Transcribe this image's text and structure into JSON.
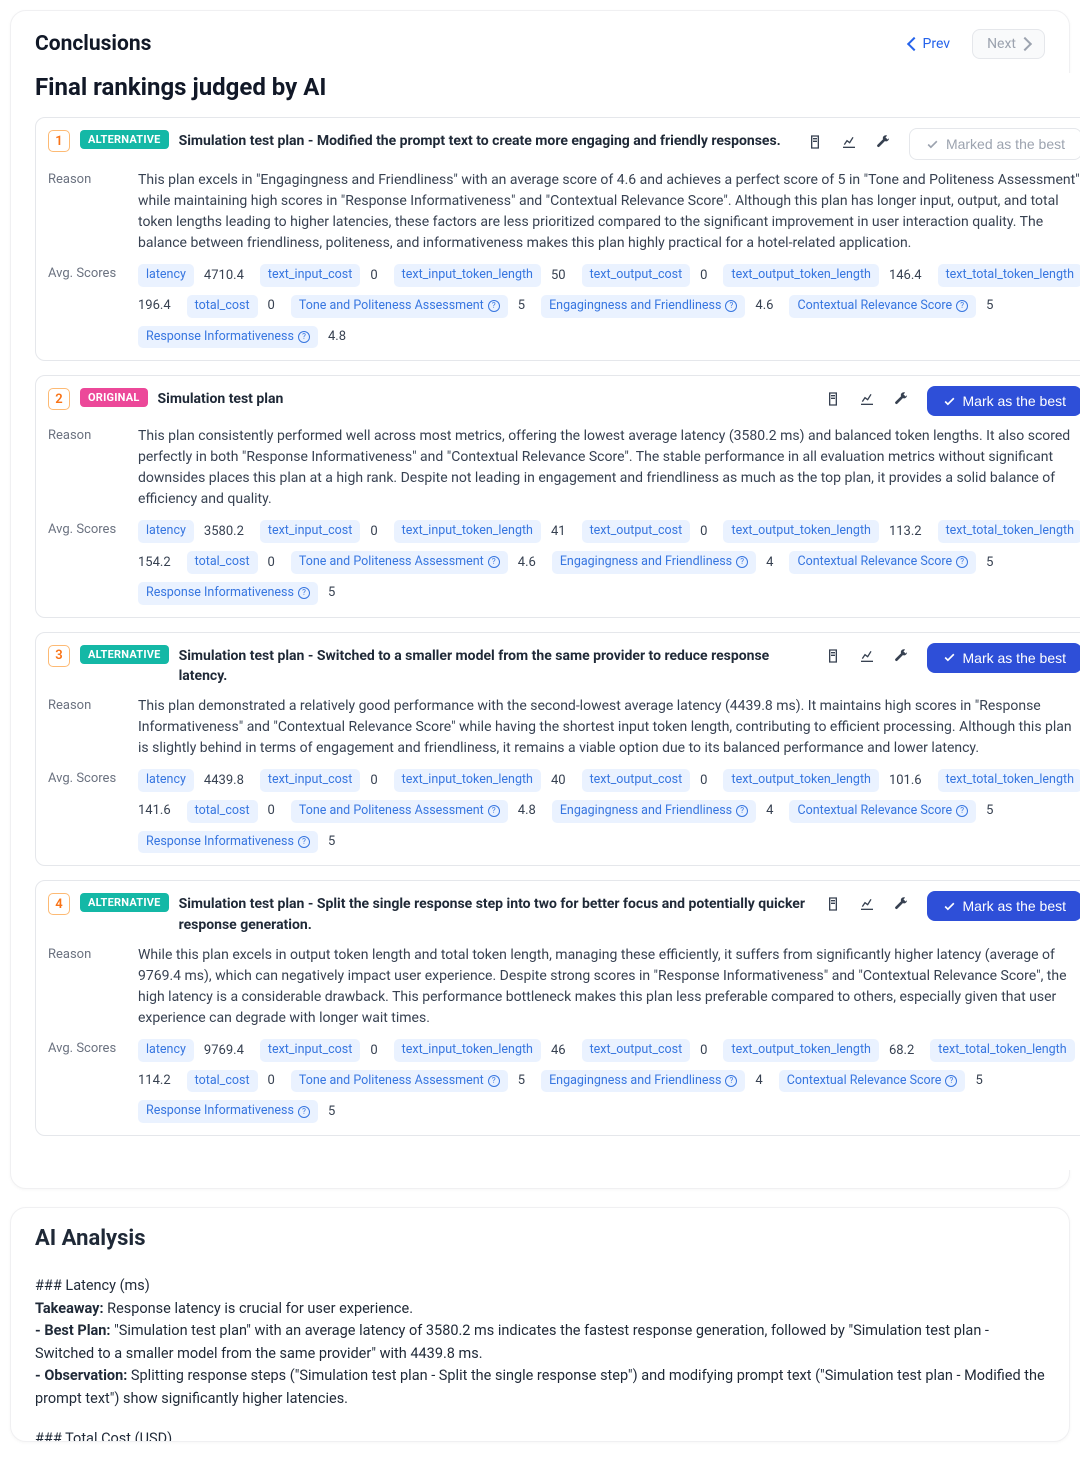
{
  "header": {
    "title": "Conclusions",
    "prev": "Prev",
    "next": "Next"
  },
  "rankings": {
    "title": "Final rankings judged by AI",
    "metric_labels": {
      "latency": "latency",
      "text_input_cost": "text_input_cost",
      "text_input_token_length": "text_input_token_length",
      "text_output_cost": "text_output_cost",
      "text_output_token_length": "text_output_token_length",
      "text_total_token_length": "text_total_token_length",
      "total_cost": "total_cost",
      "tone": "Tone and Politeness Assessment",
      "engage": "Engagingness and Friendliness",
      "context": "Contextual Relevance Score",
      "inform": "Response Informativeness"
    },
    "items": [
      {
        "rank": "1",
        "badge": "ALTERNATIVE",
        "badge_type": "alt",
        "title": "Simulation test plan - Modified the prompt text to create more engaging and friendly responses.",
        "best": {
          "marked": true,
          "label": "Marked as the best"
        },
        "reason": "This plan excels in \"Engagingness and Friendliness\" with an average score of 4.6 and achieves a perfect score of 5 in \"Tone and Politeness Assessment\" while maintaining high scores in \"Response Informativeness\" and \"Contextual Relevance Score\". Although this plan has longer input, output, and total token lengths leading to higher latencies, these factors are less prioritized compared to the significant improvement in user interaction quality. The balance between friendliness, politeness, and informativeness makes this plan highly practical for a hotel-related application.",
        "scores": {
          "latency": "4710.4",
          "text_input_cost": "0",
          "text_input_token_length": "50",
          "text_output_cost": "0",
          "text_output_token_length": "146.4",
          "text_total_token_length": "196.4",
          "total_cost": "0",
          "tone": "5",
          "engage": "4.6",
          "context": "5",
          "inform": "4.8"
        }
      },
      {
        "rank": "2",
        "badge": "ORIGINAL",
        "badge_type": "orig",
        "title": "Simulation test plan",
        "best": {
          "marked": false,
          "label": "Mark as the best"
        },
        "reason": "This plan consistently performed well across most metrics, offering the lowest average latency (3580.2 ms) and balanced token lengths. It also scored perfectly in both \"Response Informativeness\" and \"Contextual Relevance Score\". The stable performance in all evaluation metrics without significant downsides places this plan at a high rank. Despite not leading in engagement and friendliness as much as the top plan, it provides a solid balance of efficiency and quality.",
        "scores": {
          "latency": "3580.2",
          "text_input_cost": "0",
          "text_input_token_length": "41",
          "text_output_cost": "0",
          "text_output_token_length": "113.2",
          "text_total_token_length": "154.2",
          "total_cost": "0",
          "tone": "4.6",
          "engage": "4",
          "context": "5",
          "inform": "5"
        }
      },
      {
        "rank": "3",
        "badge": "ALTERNATIVE",
        "badge_type": "alt",
        "title": "Simulation test plan - Switched to a smaller model from the same provider to reduce response latency.",
        "best": {
          "marked": false,
          "label": "Mark as the best"
        },
        "reason": "This plan demonstrated a relatively good performance with the second-lowest average latency (4439.8 ms). It maintains high scores in \"Response Informativeness\" and \"Contextual Relevance Score\" while having the shortest input token length, contributing to efficient processing. Although this plan is slightly behind in terms of engagement and friendliness, it remains a viable option due to its balanced performance and lower latency.",
        "scores": {
          "latency": "4439.8",
          "text_input_cost": "0",
          "text_input_token_length": "40",
          "text_output_cost": "0",
          "text_output_token_length": "101.6",
          "text_total_token_length": "141.6",
          "total_cost": "0",
          "tone": "4.8",
          "engage": "4",
          "context": "5",
          "inform": "5"
        }
      },
      {
        "rank": "4",
        "badge": "ALTERNATIVE",
        "badge_type": "alt",
        "title": "Simulation test plan - Split the single response step into two for better focus and potentially quicker response generation.",
        "best": {
          "marked": false,
          "label": "Mark as the best"
        },
        "reason": "While this plan excels in output token length and total token length, managing these efficiently, it suffers from significantly higher latency (average of 9769.4 ms), which can negatively impact user experience. Despite strong scores in \"Response Informativeness\" and \"Contextual Relevance Score\", the high latency is a considerable drawback. This performance bottleneck makes this plan less preferable compared to others, especially given that user experience can degrade with longer wait times.",
        "scores": {
          "latency": "9769.4",
          "text_input_cost": "0",
          "text_input_token_length": "46",
          "text_output_cost": "0",
          "text_output_token_length": "68.2",
          "text_total_token_length": "114.2",
          "total_cost": "0",
          "tone": "5",
          "engage": "4",
          "context": "5",
          "inform": "5"
        }
      }
    ]
  },
  "labels": {
    "reason": "Reason",
    "avg_scores": "Avg. Scores"
  },
  "analysis": {
    "title": "AI Analysis",
    "h_latency": "### Latency (ms)",
    "takeaway_label": "Takeaway:",
    "takeaway_text": " Response latency is crucial for user experience.",
    "best_label": "- Best Plan:",
    "best_text": " \"Simulation test plan\" with an average latency of 3580.2 ms indicates the fastest response generation, followed by \"Simulation test plan - Switched to a smaller model from the same provider\" with 4439.8 ms.",
    "obs_label": "- Observation:",
    "obs_text": " Splitting response steps (\"Simulation test plan - Split the single response step\") and modifying prompt text (\"Simulation test plan - Modified the prompt text\") show significantly higher latencies.",
    "h_cost": "### Total Cost (USD)"
  }
}
